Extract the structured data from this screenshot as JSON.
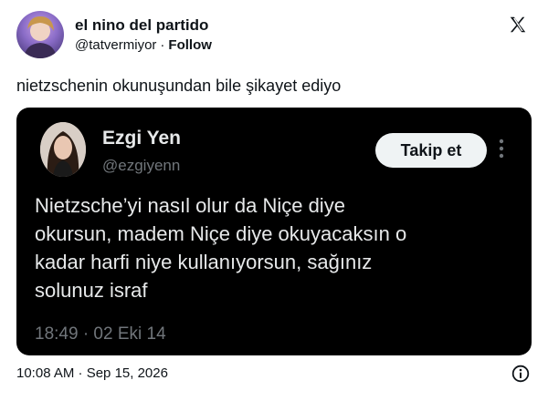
{
  "author": {
    "display_name": "el nino del partido",
    "handle": "@tatvermiyor",
    "separator": "·",
    "follow_label": "Follow",
    "avatar": "profile-avatar"
  },
  "logo": "x-logo-icon",
  "tweet": {
    "text": "nietzschenin okunuşundan bile şikayet ediyo",
    "timestamp": "10:08 AM · Sep 15, 2026"
  },
  "quoted": {
    "display_name": "Ezgi Yen",
    "handle": "@ezgiyenn",
    "follow_button_label": "Takip et",
    "body": "Nietzsche’yi nasıl olur da Niçe diye\nokursun, madem Niçe diye okuyacaksın o\nkadar harfi niye kullanıyorsun, sağınız\nsolunuz israf",
    "timestamp": "18:49 · 02 Eki 14",
    "more_icon": "more-vertical-icon"
  },
  "icons": {
    "info": "info-icon"
  },
  "colors": {
    "background": "#ffffff",
    "card": "#000000",
    "card_text": "#e7e9ea",
    "muted": "#71767b",
    "button_bg": "#eff3f4"
  }
}
